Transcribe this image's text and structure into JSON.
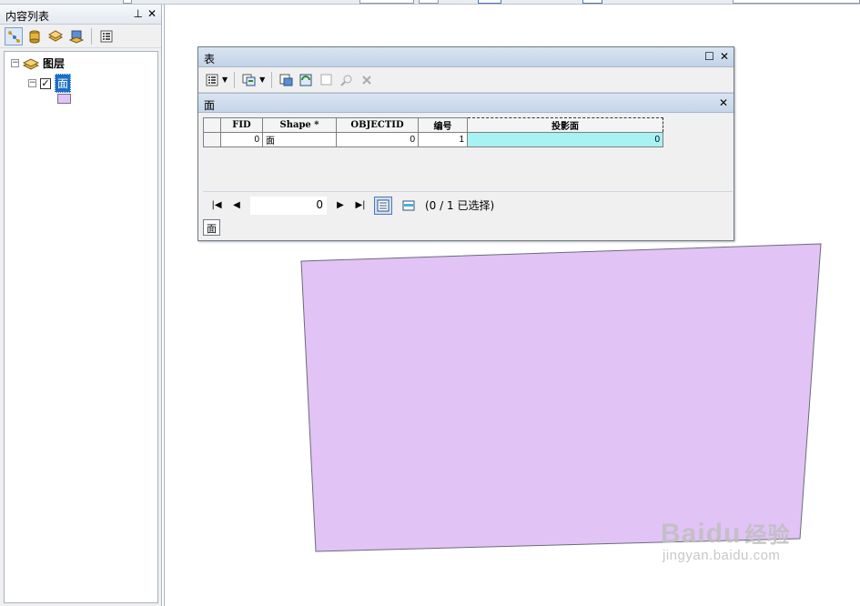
{
  "toc": {
    "title": "内容列表",
    "pin_glyph": "⊥",
    "close_glyph": "✕",
    "tree": {
      "group_label": "图层",
      "layer_label": "面",
      "layer_checked": true
    }
  },
  "table_window": {
    "title": "表",
    "tab_title": "面",
    "columns": [
      "FID",
      "Shape *",
      "OBJECTID",
      "编号",
      "投影面"
    ],
    "rows": [
      [
        "0",
        "面",
        "0",
        "1",
        "0"
      ]
    ],
    "current_record": "0",
    "selection_status": "(0 / 1 已选择)",
    "bottom_tab": "面"
  },
  "map": {
    "polygon_fill": "#e1c3f5",
    "polygon_stroke": "#6b6b7a"
  },
  "colors": {
    "arrow": "#e8322b",
    "selected_cell": "#a8f2f2",
    "selected_layer_bg": "#1c6ec4"
  },
  "watermark": {
    "brand": "Bai",
    "brand_mid": "du",
    "brand_cn": "经验",
    "url": "jingyan.baidu.com"
  }
}
